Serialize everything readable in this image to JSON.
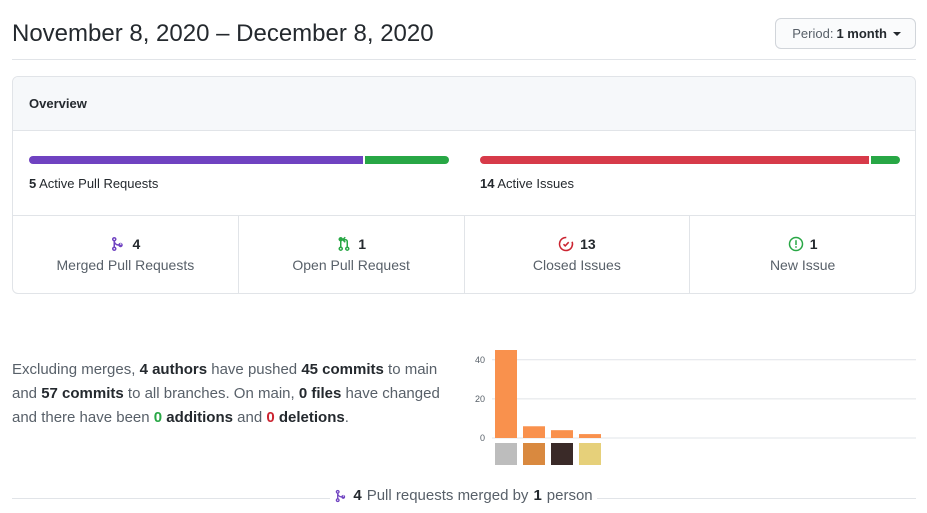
{
  "header": {
    "date_range": "November 8, 2020 – December 8, 2020",
    "period_label": "Period:",
    "period_value": "1 month"
  },
  "overview": {
    "title": "Overview",
    "pull_requests": {
      "count": "5",
      "label": "Active Pull Requests",
      "merged_fraction": 0.8,
      "open_fraction": 0.2,
      "merged_color": "#6f42c1",
      "open_color": "#28a745"
    },
    "issues": {
      "count": "14",
      "label": "Active Issues",
      "closed_fraction": 0.93,
      "new_fraction": 0.07,
      "closed_color": "#d73a49",
      "new_color": "#28a745"
    },
    "stats": [
      {
        "icon": "git-merge-icon",
        "count": "4",
        "label": "Merged Pull Requests",
        "color": "#6f42c1"
      },
      {
        "icon": "git-pull-request-icon",
        "count": "1",
        "label": "Open Pull Request",
        "color": "#28a745"
      },
      {
        "icon": "issue-closed-icon",
        "count": "13",
        "label": "Closed Issues",
        "color": "#cb2431"
      },
      {
        "icon": "issue-opened-icon",
        "count": "1",
        "label": "New Issue",
        "color": "#28a745"
      }
    ]
  },
  "summary": {
    "t1": "Excluding merges, ",
    "authors": "4 authors",
    "t2": " have pushed ",
    "commits_main": "45 commits",
    "t3": " to main and ",
    "commits_all": "57 commits",
    "t4": " to all branches. On main, ",
    "files": "0 files",
    "t5": " have changed and there have been ",
    "additions_num": "0",
    "additions_word": " additions",
    "t6": " and ",
    "deletions_num": "0",
    "deletions_word": " deletions",
    "t7": "."
  },
  "chart_data": {
    "type": "bar",
    "categories": [
      "author-1",
      "author-2",
      "author-3",
      "author-4"
    ],
    "values": [
      45,
      6,
      4,
      2
    ],
    "yticks": [
      "0",
      "20",
      "40"
    ],
    "ylim": [
      0,
      45
    ],
    "bar_color": "#f9914d",
    "avatar_colors": [
      "#bdbdbd",
      "#d9893f",
      "#3a2a28",
      "#e6d07a"
    ]
  },
  "merged_by": {
    "count": "4",
    "text": " Pull requests merged by ",
    "people": "1",
    "people_word": " person"
  }
}
